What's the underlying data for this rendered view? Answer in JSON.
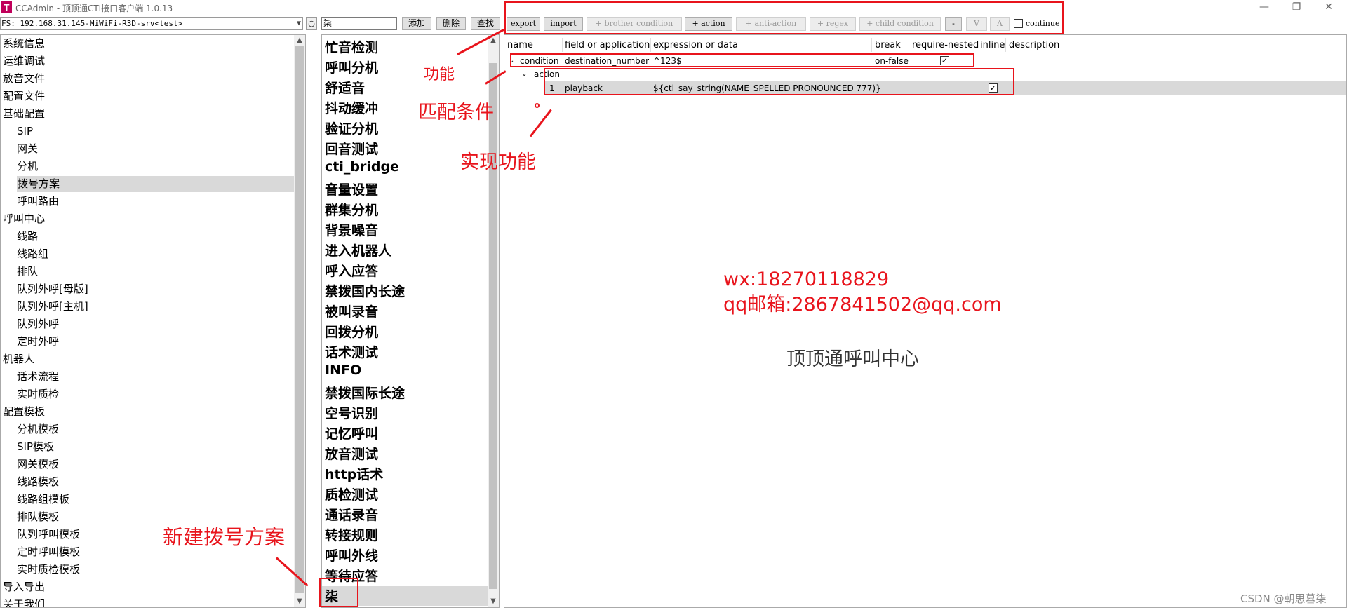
{
  "window": {
    "title": "CCAdmin - 顶顶通CTI接口客户端 1.0.13",
    "icon_letter": "T",
    "minimize": "—",
    "restore": "❐",
    "close": "✕"
  },
  "toolbar": {
    "fs_selected": "FS: 192.168.31.145-MiWiFi-R3D-srv<test>",
    "refresh": "○",
    "name_input": "柒",
    "add": "添加",
    "delete": "删除",
    "find": "查找",
    "export": "export",
    "import": "import",
    "brother_condition": "+ brother condition",
    "action": "+ action",
    "anti_action": "+ anti-action",
    "regex": "+ regex",
    "child_condition": "+ child condition",
    "remove": "-",
    "down": "V",
    "up": "Λ",
    "continue": "continue",
    "continue_checked": false
  },
  "nav": {
    "items": [
      {
        "label": "系统信息",
        "level": 0
      },
      {
        "label": "运维调试",
        "level": 0
      },
      {
        "label": "放音文件",
        "level": 0
      },
      {
        "label": "配置文件",
        "level": 0
      },
      {
        "label": "基础配置",
        "level": 0
      },
      {
        "label": "SIP",
        "level": 1
      },
      {
        "label": "网关",
        "level": 1
      },
      {
        "label": "分机",
        "level": 1
      },
      {
        "label": "拨号方案",
        "level": 1,
        "selected": true
      },
      {
        "label": "呼叫路由",
        "level": 1
      },
      {
        "label": "呼叫中心",
        "level": 0
      },
      {
        "label": "线路",
        "level": 1
      },
      {
        "label": "线路组",
        "level": 1
      },
      {
        "label": "排队",
        "level": 1
      },
      {
        "label": "队列外呼[母版]",
        "level": 1
      },
      {
        "label": "队列外呼[主机]",
        "level": 1
      },
      {
        "label": "队列外呼",
        "level": 1
      },
      {
        "label": "定时外呼",
        "level": 1
      },
      {
        "label": "机器人",
        "level": 0
      },
      {
        "label": "话术流程",
        "level": 1
      },
      {
        "label": "实时质检",
        "level": 1
      },
      {
        "label": "配置模板",
        "level": 0
      },
      {
        "label": "分机模板",
        "level": 1
      },
      {
        "label": "SIP模板",
        "level": 1
      },
      {
        "label": "网关模板",
        "level": 1
      },
      {
        "label": "线路模板",
        "level": 1
      },
      {
        "label": "线路组模板",
        "level": 1
      },
      {
        "label": "排队模板",
        "level": 1
      },
      {
        "label": "队列呼叫模板",
        "level": 1
      },
      {
        "label": "定时呼叫模板",
        "level": 1
      },
      {
        "label": "实时质检模板",
        "level": 1
      },
      {
        "label": "导入导出",
        "level": 0
      },
      {
        "label": "关于我们",
        "level": 0
      }
    ]
  },
  "plans": {
    "items": [
      "忙音检测",
      "呼叫分机",
      "舒适音",
      "抖动缓冲",
      "验证分机",
      "回音测试",
      "cti_bridge",
      "音量设置",
      "群集分机",
      "背景噪音",
      "进入机器人",
      "呼入应答",
      "禁拨国内长途",
      "被叫录音",
      "回拨分机",
      "话术测试",
      "INFO",
      "禁拨国际长途",
      "空号识别",
      "记忆呼叫",
      "放音测试",
      "http话术",
      "质检测试",
      "通话录音",
      "转接规则",
      "呼叫外线",
      "等待应答",
      "柒"
    ],
    "selected_index": 27
  },
  "table": {
    "headers": [
      "name",
      "field or application",
      "expression or data",
      "break",
      "require-nested",
      "inline",
      "description"
    ],
    "condition": {
      "name": "condition",
      "field": "destination_number",
      "expression": "^123$",
      "break": "on-false",
      "require_nested": true
    },
    "action_group": {
      "name": "action"
    },
    "action_row": {
      "index": "1",
      "application": "playback",
      "data": "${cti_say_string(NAME_SPELLED PRONOUNCED  777)}",
      "inline": true
    }
  },
  "annotations": {
    "function": "功能",
    "match_condition": "匹配条件",
    "implement": "实现功能",
    "new_plan": "新建拨号方案",
    "wx": "wx:18270118829",
    "qq": "qq邮箱:2867841502@qq.com",
    "company": "顶顶通呼叫中心",
    "watermark": "CSDN @朝思暮柒",
    "color": "#e8141c"
  }
}
